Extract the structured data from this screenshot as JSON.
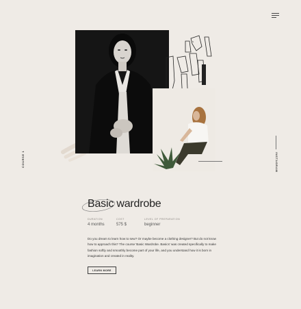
{
  "side": {
    "course_label": "COURSE 1",
    "instagram_label": "INSTAGRAM"
  },
  "course": {
    "title": "Basic wardrobe",
    "duration_label": "DURATION",
    "duration_value": "4 months",
    "cost_label": "COST",
    "cost_value": "575 $",
    "level_label": "LEVEL OF PREPARATION",
    "level_value": "beginner",
    "description": "Do you dream to learn how to sew? Or maybe become a clothing designer? But do not know how to approach this? The course 'Basic Wardrobe. Basics' was created specifically to make fashion softly and smoothly become part of your life, and you understand how it is born in imagination and created in reality.",
    "button_label": "LEARN MORE"
  },
  "icons": {
    "menu": "hamburger-menu-icon"
  },
  "colors": {
    "background": "#efebe6",
    "text": "#2b2b2b",
    "muted": "#8a8580"
  }
}
